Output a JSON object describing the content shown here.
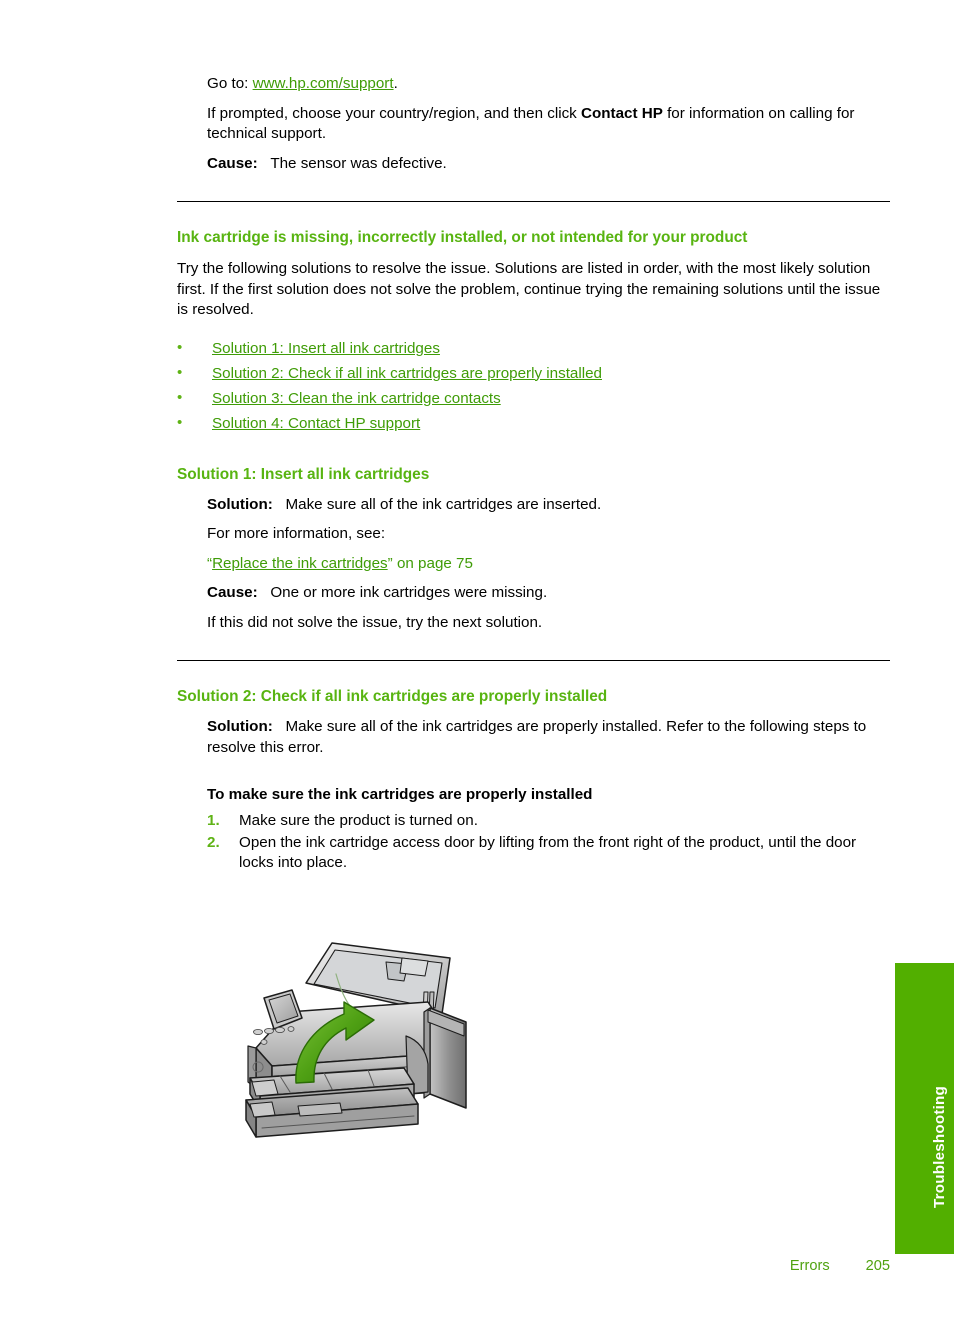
{
  "document": {
    "intro": {
      "goto_prefix": "Go to: ",
      "goto_link": "www.hp.com/support",
      "goto_suffix": ".",
      "prompted_1": "If prompted, choose your country/region, and then click ",
      "prompted_bold": "Contact HP",
      "prompted_2": " for information on calling for technical support.",
      "cause_label": "Cause:",
      "cause_text": "The sensor was defective."
    },
    "error_section": {
      "heading": "Ink cartridge is missing, incorrectly installed, or not intended for your product",
      "intro_paragraph": "Try the following solutions to resolve the issue. Solutions are listed in order, with the most likely solution first. If the first solution does not solve the problem, continue trying the remaining solutions until the issue is resolved.",
      "links": [
        "Solution 1: Insert all ink cartridges",
        "Solution 2: Check if all ink cartridges are properly installed",
        "Solution 3: Clean the ink cartridge contacts",
        "Solution 4: Contact HP support"
      ]
    },
    "solution1": {
      "heading": "Solution 1: Insert all ink cartridges",
      "solution_label": "Solution:",
      "solution_text": "Make sure all of the ink cartridges are inserted.",
      "more_info": "For more information, see:",
      "xref_open_quote": "“",
      "xref_link": "Replace the ink cartridges",
      "xref_close_quote": "”",
      "xref_page": " on page 75",
      "cause_label": "Cause:",
      "cause_text": "One or more ink cartridges were missing.",
      "next_solution": "If this did not solve the issue, try the next solution."
    },
    "solution2": {
      "heading": "Solution 2: Check if all ink cartridges are properly installed",
      "solution_label": "Solution:",
      "solution_text": "Make sure all of the ink cartridges are properly installed. Refer to the following steps to resolve this error.",
      "procedure_heading": "To make sure the ink cartridges are properly installed",
      "steps": [
        {
          "num": "1.",
          "text": "Make sure the product is turned on."
        },
        {
          "num": "2.",
          "text": "Open the ink cartridge access door by lifting from the front right of the product, until the door locks into place."
        }
      ]
    },
    "figure": {
      "caption": "",
      "alt": "All-in-one printer with ink cartridge access door lifted open, green curved arrow indicating upward lifting motion"
    },
    "side_tab": {
      "label": "Troubleshooting"
    },
    "footer": {
      "section": "Errors",
      "page_number": "205"
    },
    "colors": {
      "heading_green": "#58b411",
      "link_green": "#3f9c07",
      "tab_green": "#52af00",
      "footer_green": "#4fa210",
      "bullet_green": "#5fb316"
    }
  }
}
